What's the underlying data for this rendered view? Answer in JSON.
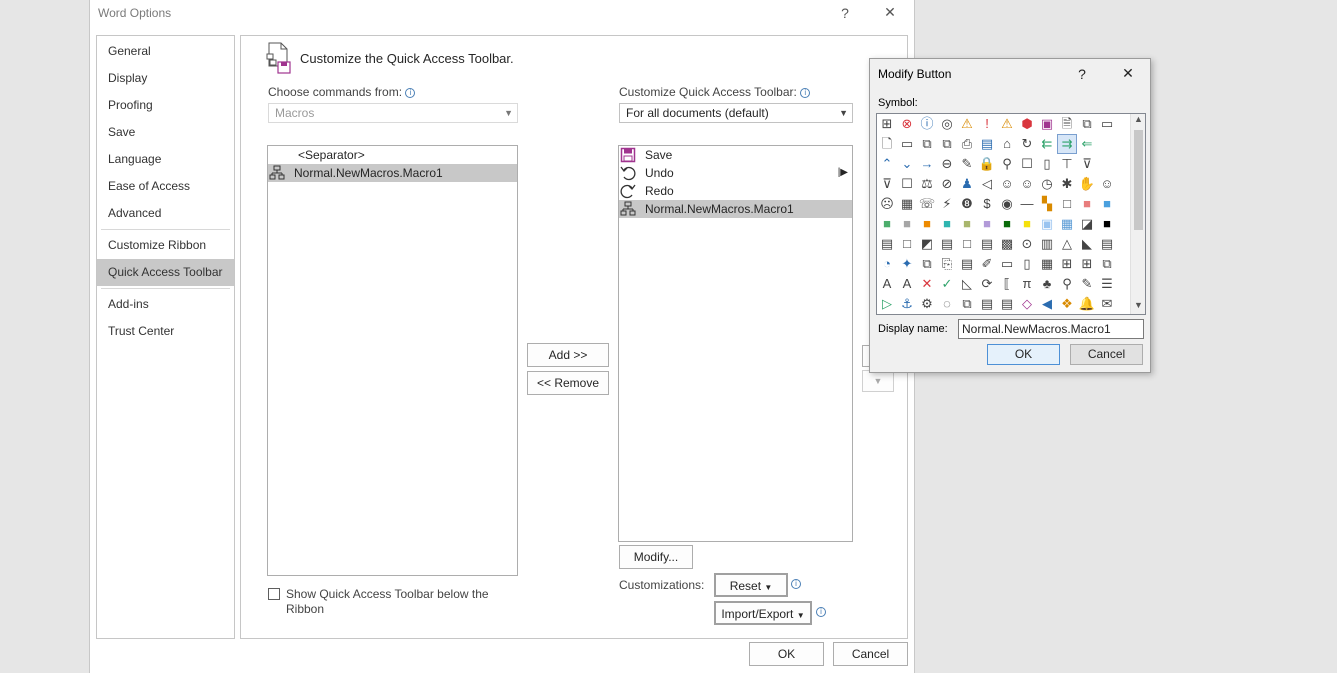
{
  "window": {
    "title": "Word Options",
    "help": "?",
    "close": "✕"
  },
  "nav": {
    "items": [
      {
        "label": "General",
        "selected": false
      },
      {
        "label": "Display",
        "selected": false
      },
      {
        "label": "Proofing",
        "selected": false
      },
      {
        "label": "Save",
        "selected": false
      },
      {
        "label": "Language",
        "selected": false
      },
      {
        "label": "Ease of Access",
        "selected": false
      },
      {
        "label": "Advanced",
        "selected": false
      },
      {
        "label": "Customize Ribbon",
        "selected": false
      },
      {
        "label": "Quick Access Toolbar",
        "selected": true
      },
      {
        "label": "Add-ins",
        "selected": false
      },
      {
        "label": "Trust Center",
        "selected": false
      }
    ]
  },
  "main": {
    "heading": "Customize the Quick Access Toolbar.",
    "choose_label": "Choose commands from:",
    "choose_value": "Macros",
    "source_items": [
      "<Separator>",
      "Normal.NewMacros.Macro1"
    ],
    "customize_label": "Customize Quick Access Toolbar:",
    "customize_value": "For all documents (default)",
    "toolbar_items": [
      "Save",
      "Undo",
      "Redo",
      "Normal.NewMacros.Macro1"
    ],
    "add_button": "Add >>",
    "remove_button": "<< Remove",
    "modify_button": "Modify...",
    "customizations_label": "Customizations:",
    "reset_button": "Reset",
    "import_export_button": "Import/Export",
    "show_below_label": "Show Quick Access Toolbar below the Ribbon",
    "ok_button": "OK",
    "cancel_button": "Cancel"
  },
  "modify_dialog": {
    "title": "Modify Button",
    "help": "?",
    "close": "✕",
    "symbol_label": "Symbol:",
    "display_name_label": "Display name:",
    "display_name_value": "Normal.NewMacros.Macro1",
    "ok_button": "OK",
    "cancel_button": "Cancel"
  },
  "colors": {
    "accent": "#4d90d6",
    "selection": "#c8c8c8",
    "save_purple": "#a0348f",
    "swatches": [
      "#4cad6c",
      "#a6a6a6",
      "#ed8a00",
      "#2fb5b0",
      "#a9b66d",
      "#b29ad8",
      "#0a6b0a",
      "#f5e10b",
      "#9ac4f0",
      "#9bc7ee",
      "#1a1a1a",
      "#000000"
    ]
  }
}
